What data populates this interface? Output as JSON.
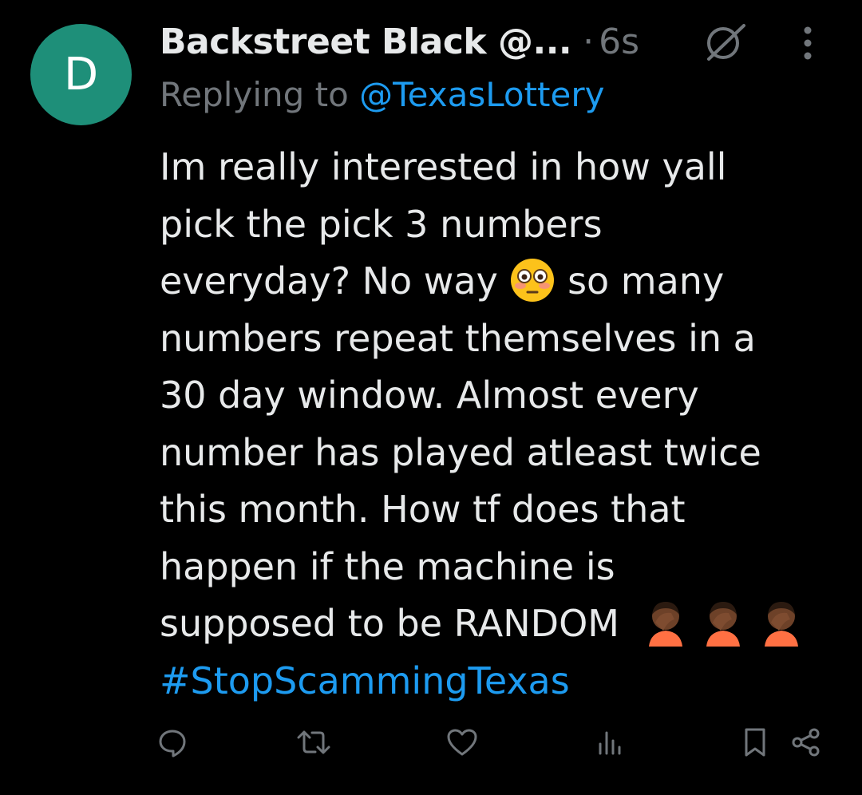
{
  "tweet": {
    "avatar_letter": "D",
    "display_name": "Backstreet Black @...",
    "separator": "·",
    "time": "6s",
    "replying_prefix": "Replying to ",
    "replying_handle": "@TexasLottery",
    "body_lines": [
      "Im really interested in how yall",
      "pick the pick 3 numbers",
      "everyday? No way",
      "so many",
      "numbers repeat themselves in a",
      "30 day window.  Almost every",
      "number has played atleast twice",
      "this month. How tf does that",
      "happen if the machine is",
      "supposed to be RANDOM"
    ],
    "hashtag": "#StopScammingTexas",
    "emojis": {
      "flushed": "flushed-face",
      "facepalm": "person-facepalming"
    }
  },
  "actions": [
    "reply-icon",
    "retweet-icon",
    "like-icon",
    "views-icon",
    "bookmark-icon",
    "share-icon"
  ],
  "colors": {
    "background": "#000000",
    "text": "#e7e9ea",
    "muted": "#71767b",
    "link": "#1d9bf0",
    "avatar": "#1e8f79"
  }
}
